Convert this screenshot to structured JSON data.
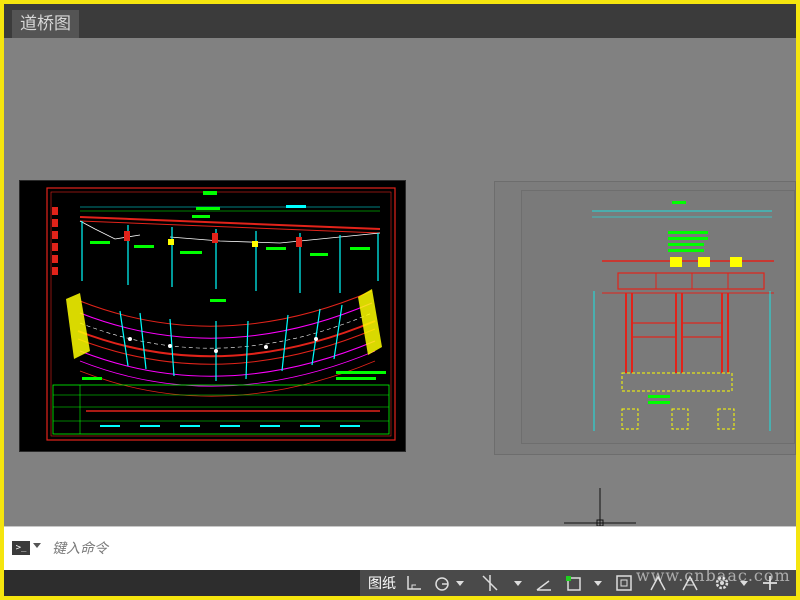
{
  "tabs": [
    {
      "label": "道桥图"
    }
  ],
  "command_line": {
    "placeholder": "键入命令"
  },
  "status_bar": {
    "layout_label": "图纸",
    "icons": [
      "snap-icon",
      "polar-tracking-icon",
      "osnap-icon",
      "isodraft-icon",
      "object-snap-icon",
      "viewport-icon",
      "annotation-scale-icon",
      "workspace-gear-icon",
      "add-icon"
    ]
  },
  "watermark": {
    "text": "www.cnbaac.com"
  },
  "colors": {
    "canvas": "#818181",
    "cad_red": "#e2231a",
    "cad_green": "#00ff00",
    "cad_cyan": "#00ffff",
    "cad_magenta": "#ff00ff",
    "cad_yellow": "#ffff00"
  }
}
